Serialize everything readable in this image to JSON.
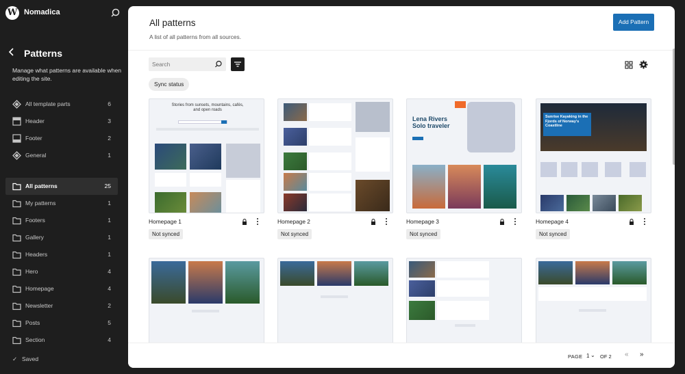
{
  "sidebar": {
    "site_name": "Nomadica",
    "title": "Patterns",
    "description": "Manage what patterns are available when editing the site.",
    "template_parts": [
      {
        "label": "All template parts",
        "count": "6",
        "icon": "symbol-icon"
      },
      {
        "label": "Header",
        "count": "3",
        "icon": "header-icon"
      },
      {
        "label": "Footer",
        "count": "2",
        "icon": "footer-icon"
      },
      {
        "label": "General",
        "count": "1",
        "icon": "symbol-icon"
      }
    ],
    "categories": [
      {
        "label": "All patterns",
        "count": "25",
        "active": true
      },
      {
        "label": "My patterns",
        "count": "1"
      },
      {
        "label": "Footers",
        "count": "1"
      },
      {
        "label": "Gallery",
        "count": "1"
      },
      {
        "label": "Headers",
        "count": "1"
      },
      {
        "label": "Hero",
        "count": "4"
      },
      {
        "label": "Homepage",
        "count": "4"
      },
      {
        "label": "Newsletter",
        "count": "2"
      },
      {
        "label": "Posts",
        "count": "5"
      },
      {
        "label": "Section",
        "count": "4"
      }
    ],
    "saved": "Saved"
  },
  "header": {
    "title": "All patterns",
    "description": "A list of all patterns from all sources.",
    "add_button": "Add Pattern"
  },
  "toolbar": {
    "search_placeholder": "Search",
    "sync_filter": "Sync status"
  },
  "patterns": [
    {
      "title": "Homepage 1",
      "status": "Not synced"
    },
    {
      "title": "Homepage 2",
      "status": "Not synced"
    },
    {
      "title": "Homepage 3",
      "status": "Not synced"
    },
    {
      "title": "Homepage 4",
      "status": "Not synced"
    }
  ],
  "previews": {
    "p1_heading": "Stories from sunsets, mountains, cafés, and open roads",
    "p3_heading": "Lena Rivers Solo traveler",
    "p4_heading": "Sunrise Kayaking in the Fjords of Norway's Coastline"
  },
  "pagination": {
    "page_label": "PAGE",
    "current_page": "1",
    "of_label": "OF 2"
  },
  "colors": {
    "sidebar_bg": "#1e1e1e",
    "accent": "#1b6fb5"
  }
}
